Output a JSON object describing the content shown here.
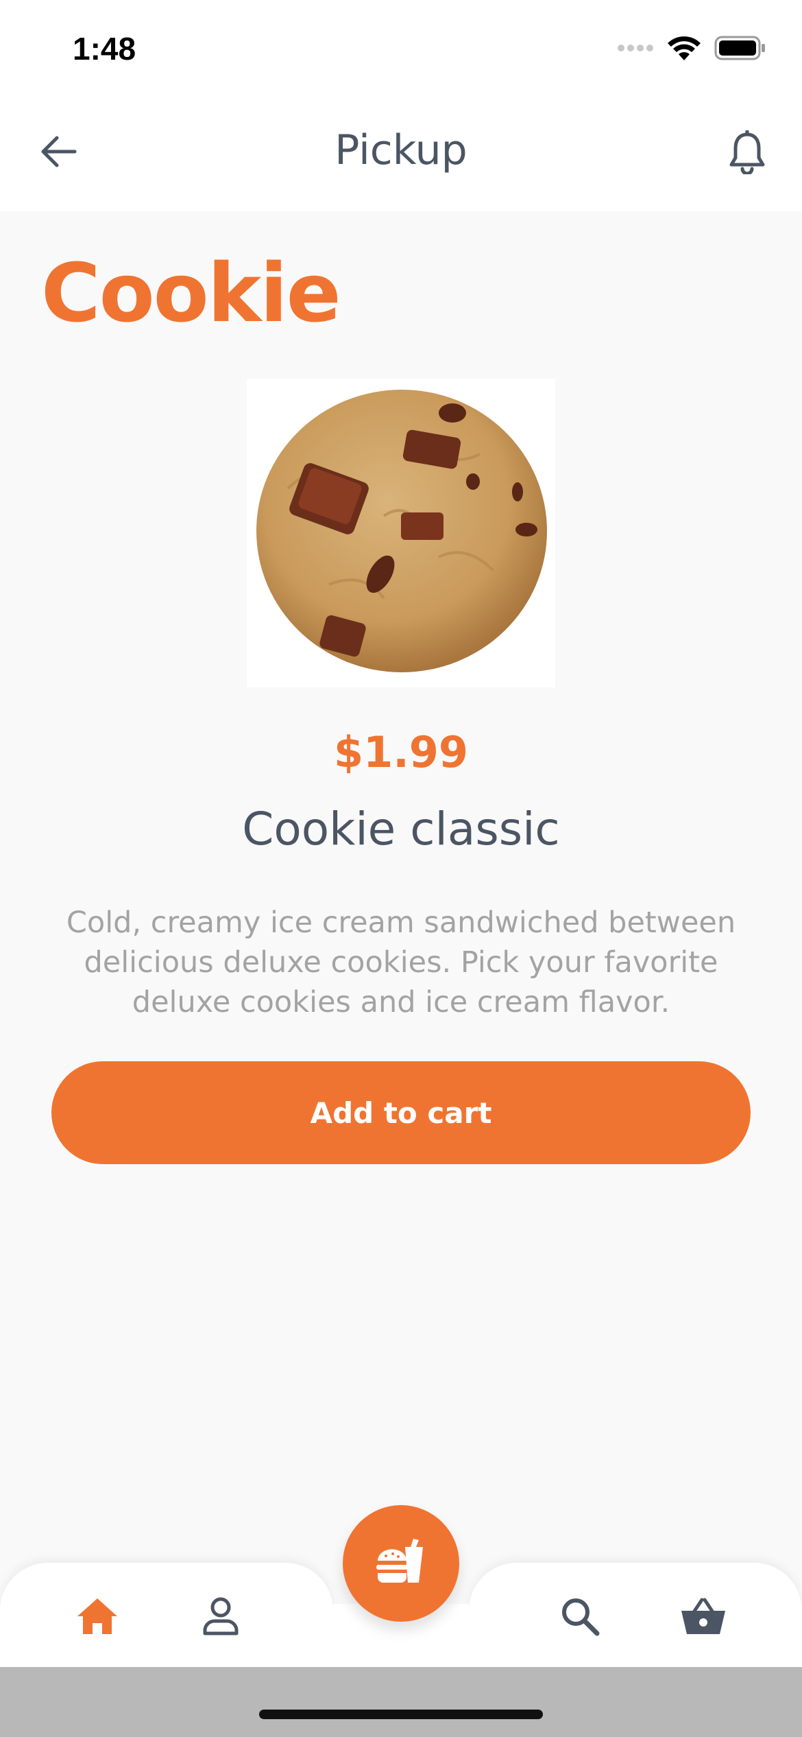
{
  "status_bar": {
    "time": "1:48"
  },
  "header": {
    "title": "Pickup",
    "back_icon": "arrow-left-icon",
    "notification_icon": "bell-icon"
  },
  "product": {
    "category": "Cookie",
    "price": "$1.99",
    "name": "Cookie classic",
    "description": "Cold, creamy ice cream sandwiched between delicious deluxe cookies. Pick your favorite deluxe cookies and ice cream flavor.",
    "image": "chocolate-chunk-cookie-image"
  },
  "actions": {
    "add_to_cart_label": "Add to cart"
  },
  "bottom_nav": {
    "items": [
      {
        "name": "home",
        "icon": "home-icon",
        "active": true
      },
      {
        "name": "profile",
        "icon": "user-icon",
        "active": false
      },
      {
        "name": "menu",
        "icon": "burger-drink-icon",
        "active": false
      },
      {
        "name": "search",
        "icon": "search-icon",
        "active": false
      },
      {
        "name": "cart",
        "icon": "basket-icon",
        "active": false
      }
    ]
  },
  "colors": {
    "accent": "#f07431",
    "text_dark": "#4b5563",
    "text_muted": "#a3a3a3",
    "background": "#f9f9f9"
  }
}
